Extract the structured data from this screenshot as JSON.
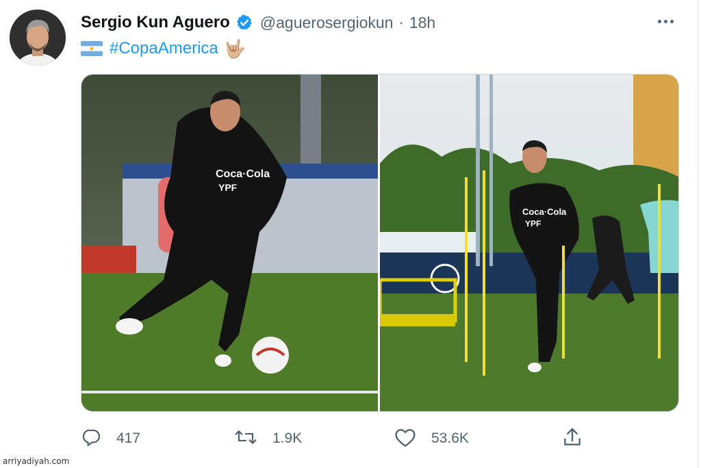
{
  "tweet": {
    "author_name": "Sergio Kun Aguero",
    "handle": "@aguerosergiokun",
    "separator": "·",
    "time": "18h",
    "hashtag": "#CopaAmerica",
    "emoji": "🤟🏼"
  },
  "actions": {
    "replies": "417",
    "retweets": "1.9K",
    "likes": "53.6K"
  },
  "icons": {
    "verified": "verified-badge-icon",
    "flag": "argentina-flag-icon",
    "more": "more-icon",
    "reply": "reply-icon",
    "retweet": "retweet-icon",
    "like": "heart-icon",
    "share": "share-icon"
  },
  "colors": {
    "accent": "#1d9bf0",
    "secondary_text": "#536471"
  },
  "watermark": "arriyadiyah.com"
}
